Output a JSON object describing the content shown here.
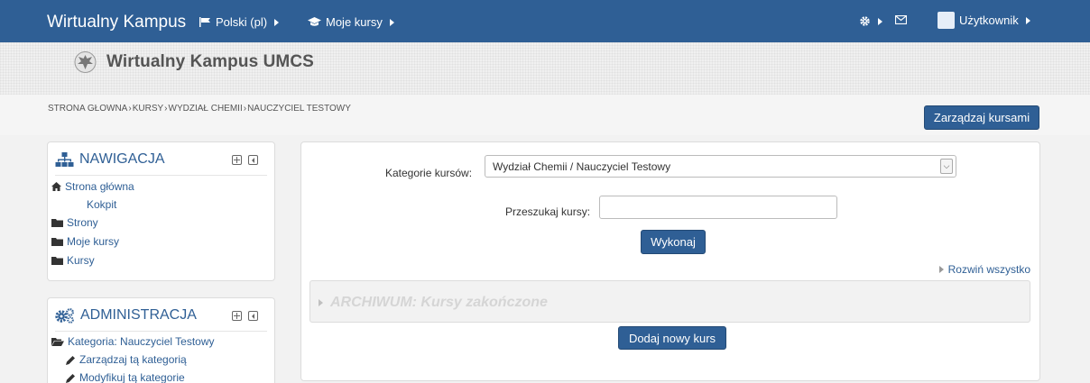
{
  "navbar": {
    "brand": "Wirtualny Kampus",
    "language": "Polski (pl)",
    "my_courses": "Moje kursy",
    "user": "Użytkownik"
  },
  "header": {
    "logo_text": "Wirtualny Kampus UMCS"
  },
  "breadcrumb": [
    "STRONA GŁOWNA",
    "KURSY",
    "WYDZIAŁ CHEMII",
    "NAUCZYCIEL TESTOWY"
  ],
  "manage_courses_button": "Zarządzaj kursami",
  "navigation_block": {
    "title": "NAWIGACJA",
    "items": [
      "Strona główna",
      "Kokpit",
      "Strony",
      "Moje kursy",
      "Kursy"
    ]
  },
  "admin_block": {
    "title": "ADMINISTRACJA",
    "items": [
      "Kategoria: Nauczyciel Testowy",
      "Zarządzaj tą kategorią",
      "Modyfikuj tą kategorie"
    ]
  },
  "main": {
    "category_label": "Kategorie kursów:",
    "category_selected": "Wydział Chemii / Nauczyciel Testowy",
    "search_label": "Przeszukaj kursy:",
    "search_value": "",
    "search_button": "Wykonaj",
    "expand_all": "Rozwiń wszystko",
    "archive_category": "ARCHIWUM: Kursy zakończone",
    "add_course_button": "Dodaj nowy kurs"
  },
  "colors": {
    "navbar": "#2f5f95",
    "link": "#2f5f95",
    "button": "#2f5f95"
  }
}
